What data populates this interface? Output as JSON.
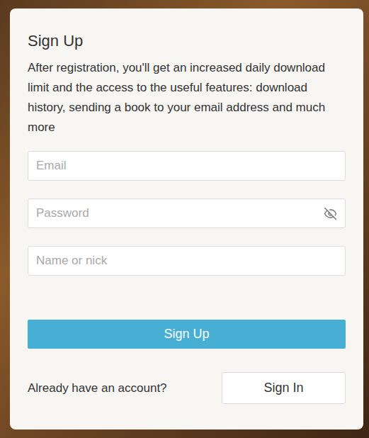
{
  "form": {
    "title": "Sign Up",
    "description": "After registration, you'll get an increased daily download limit and the access to the useful features: download history, sending a book to your email address and much more",
    "fields": [
      {
        "placeholder": "Email",
        "kind": "text"
      },
      {
        "placeholder": "Password",
        "kind": "password"
      },
      {
        "placeholder": "Name or nick",
        "kind": "text"
      }
    ],
    "submit_button": "Sign Up",
    "footer": {
      "text": "Already have an account?",
      "button": "Sign In"
    }
  }
}
